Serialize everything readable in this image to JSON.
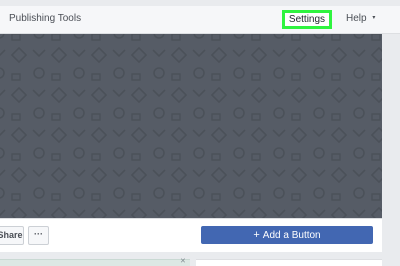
{
  "navbar": {
    "publishing_tools_label": "Publishing Tools",
    "settings_label": "Settings",
    "help_label": "Help",
    "help_caret": "▾"
  },
  "cover": {
    "background_color": "#565c66",
    "pattern_color": "#4d535c"
  },
  "actions": {
    "share_label": "Share",
    "more_label": "···",
    "add_button_plus": "+",
    "add_button_label": "Add a Button"
  },
  "colors": {
    "settings_highlight": "#2ff43f",
    "primary_button": "#4267b2"
  }
}
